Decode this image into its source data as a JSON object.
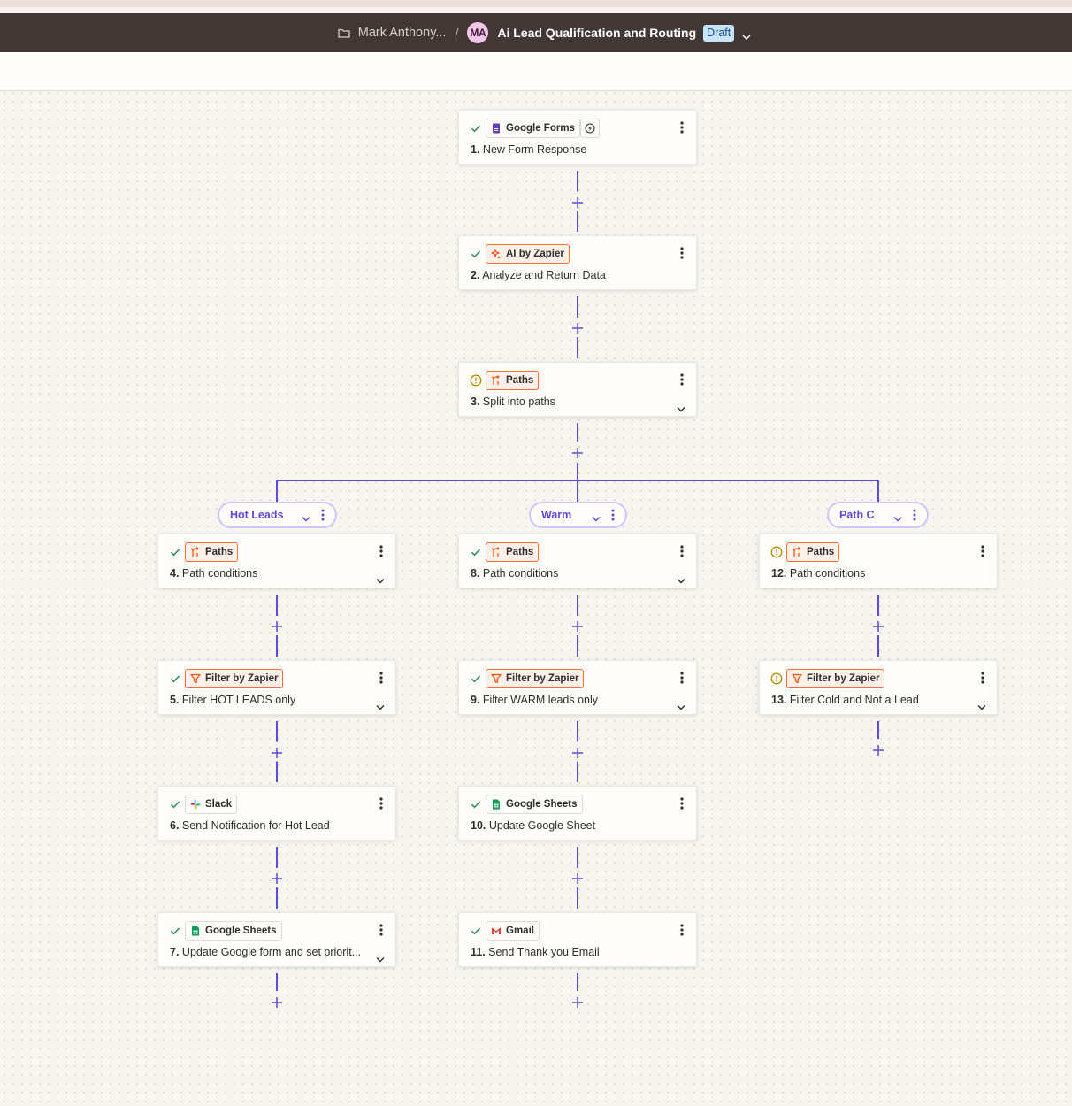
{
  "header": {
    "crumb": "Mark Anthony...",
    "separator": "/",
    "avatar": "MA",
    "title": "Ai Lead Qualification and Routing",
    "badge": "Draft"
  },
  "colors": {
    "header_bg": "#413735",
    "connector": "#5c4bd6",
    "ok": "#2e8b57",
    "warn": "#b58900",
    "chip_orange": "#ff6d3a",
    "badge_bg": "#c6e4fb"
  },
  "paths": {
    "hot": {
      "label": "Hot Leads"
    },
    "warm": {
      "label": "Warm"
    },
    "c": {
      "label": "Path C"
    }
  },
  "steps": [
    {
      "id": 1,
      "num": "1.",
      "text": "New Form Response",
      "app": "Google Forms",
      "icon": "google-forms-icon",
      "status": "ok",
      "orange": false,
      "expand": false,
      "trigger": true
    },
    {
      "id": 2,
      "num": "2.",
      "text": "Analyze and Return Data",
      "app": "AI by Zapier",
      "icon": "ai-sparkle-icon",
      "status": "ok",
      "orange": true,
      "expand": false
    },
    {
      "id": 3,
      "num": "3.",
      "text": "Split into paths",
      "app": "Paths",
      "icon": "paths-icon",
      "status": "warn",
      "orange": true,
      "expand": true
    },
    {
      "id": 4,
      "num": "4.",
      "text": "Path conditions",
      "app": "Paths",
      "icon": "paths-icon",
      "status": "ok",
      "orange": true,
      "expand": true
    },
    {
      "id": 5,
      "num": "5.",
      "text": "Filter HOT LEADS only",
      "app": "Filter by Zapier",
      "icon": "filter-icon",
      "status": "ok",
      "orange": true,
      "expand": true
    },
    {
      "id": 6,
      "num": "6.",
      "text": "Send Notification for Hot Lead",
      "app": "Slack",
      "icon": "slack-icon",
      "status": "ok",
      "orange": false,
      "expand": false
    },
    {
      "id": 7,
      "num": "7.",
      "text": "Update Google form and set priorit...",
      "app": "Google Sheets",
      "icon": "google-sheets-icon",
      "status": "ok",
      "orange": false,
      "expand": true
    },
    {
      "id": 8,
      "num": "8.",
      "text": "Path conditions",
      "app": "Paths",
      "icon": "paths-icon",
      "status": "ok",
      "orange": true,
      "expand": true
    },
    {
      "id": 9,
      "num": "9.",
      "text": "Filter WARM leads only",
      "app": "Filter by Zapier",
      "icon": "filter-icon",
      "status": "ok",
      "orange": true,
      "expand": true
    },
    {
      "id": 10,
      "num": "10.",
      "text": "Update Google Sheet",
      "app": "Google Sheets",
      "icon": "google-sheets-icon",
      "status": "ok",
      "orange": false,
      "expand": false
    },
    {
      "id": 11,
      "num": "11.",
      "text": "Send Thank you Email",
      "app": "Gmail",
      "icon": "gmail-icon",
      "status": "ok",
      "orange": false,
      "expand": false
    },
    {
      "id": 12,
      "num": "12.",
      "text": "Path conditions",
      "app": "Paths",
      "icon": "paths-icon",
      "status": "warn",
      "orange": true,
      "expand": false
    },
    {
      "id": 13,
      "num": "13.",
      "text": "Filter Cold and Not a Lead",
      "app": "Filter by Zapier",
      "icon": "filter-icon",
      "status": "warn",
      "orange": true,
      "expand": true
    }
  ]
}
